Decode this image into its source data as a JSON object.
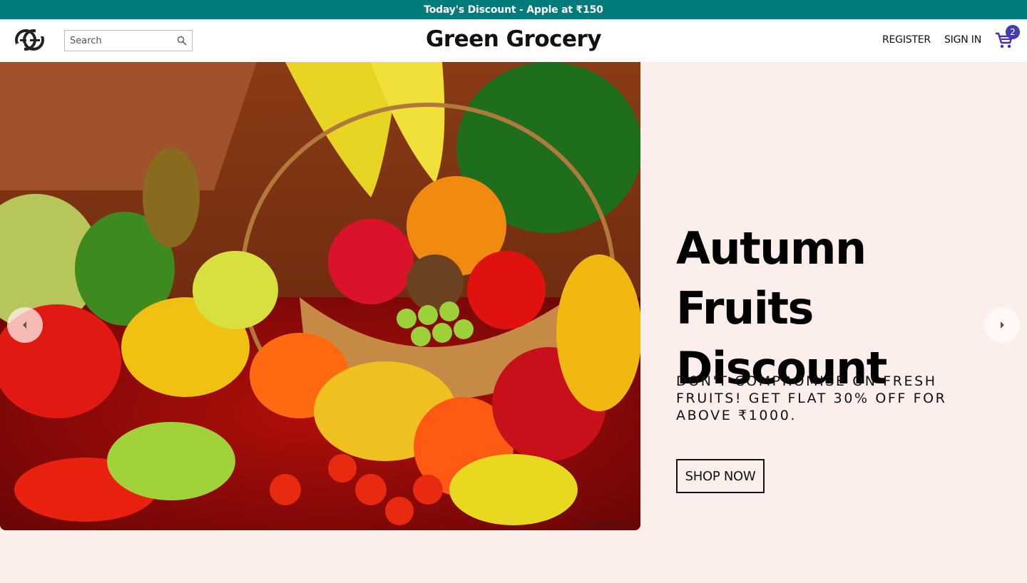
{
  "announcement": {
    "text": "Today's Discount - Apple at ₹150"
  },
  "header": {
    "brand": "Green Grocery",
    "search": {
      "placeholder": "Search",
      "value": ""
    },
    "nav": {
      "register": "REGISTER",
      "signin": "SIGN IN"
    },
    "cart": {
      "count": "2"
    }
  },
  "slide": {
    "title": "Autumn Fruits Discount",
    "subtitle": "DON'T COMPROMISE ON FRESH FRUITS! GET FLAT 30% OFF FOR ABOVE ₹1000.",
    "cta": "SHOP NOW",
    "image_watermark": "s.blogspot.com"
  },
  "colors": {
    "announcement_bg": "#007b7b",
    "hero_bg": "#fcefeb",
    "badge": "#3f3fae",
    "cart_icon": "#4b2bb5"
  },
  "icons": [
    "logo-icon",
    "search-icon",
    "cart-icon",
    "arrow-left-icon",
    "arrow-right-icon"
  ]
}
